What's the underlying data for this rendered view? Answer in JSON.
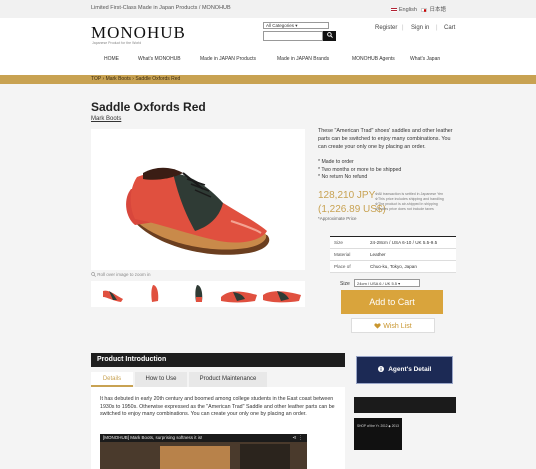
{
  "topbar": {
    "tagline": "Limited First-Class Made in Japan Products / MONOHUB",
    "lang_english": "English",
    "lang_japanese": "日本語"
  },
  "header": {
    "logo": "MONOHUB",
    "logo_subtitle": "Japanese Product for the World",
    "category_select": "All Categories",
    "search_placeholder": "",
    "register": "Register",
    "sign_in": "Sign in",
    "cart": "Cart",
    "separator": "|"
  },
  "nav": {
    "items": [
      "HOME",
      "What's MONOHUB",
      "Made in JAPAN Products",
      "Made in JAPAN Brands",
      "MONOHUB Agents",
      "What's Japan"
    ]
  },
  "breadcrumb": {
    "items": [
      "TOP",
      "Mark Boots",
      "Saddle Oxfords Red"
    ],
    "separator": "›"
  },
  "product": {
    "title": "Saddle Oxfords Red",
    "brand": "Mark Boots",
    "zoom_hint": "Roll over image to zoom in",
    "description": "These \"American Trad\" shoes' saddles and other leather parts can be switched to enjoy many combinations. You can create your only one by placing an order.",
    "bullets": [
      "* Made to order",
      "* Two months or more to be shipped",
      "* No return No refund"
    ],
    "price_jpy": "128,210 JPY",
    "price_usd": "(1,226.89 US$)",
    "approx_label": "*Approximate Price",
    "price_notes": [
      "※All transaction is settled in Japanese Yen",
      "※This price includes shipping and handling",
      "※The product is air-shipped in shipping",
      "※Duties price does not include taxes"
    ],
    "specs": [
      {
        "key": "Size",
        "value": "24-28cm / USA 6-10 / UK 5.5-9.5"
      },
      {
        "key": "Material",
        "value": "Leather"
      },
      {
        "key": "Place of",
        "value": "Chuo-ku, Tokyo, Japan"
      }
    ],
    "size_label": "Size",
    "size_selected": "24cm / USA 6 / UK 5.5",
    "add_to_cart": "Add to Cart",
    "wish_list": "Wish List"
  },
  "intro": {
    "heading": "Product Introduction",
    "tabs": [
      "Details",
      "How to Use",
      "Product Maintenance"
    ],
    "active_tab": "Details",
    "text": "It has debuted in early 20th century and boomed among college students in the East coast between 1930s to 1950s. Otherwise expressed as the \"American Trad\" Saddle and other leather parts can be switched to enjoy many combinations. You can create your only one by placing an order.",
    "video_title": "[MONOHUB] Mark Boots, surprising softness it is!"
  },
  "sidebar": {
    "agent_button": "Agent's Detail",
    "badge_text": "SHOP of the Yr. 2012 ◆ 2013"
  },
  "colors": {
    "accent_gold": "#c8a252",
    "cart_button": "#d9a43c",
    "agent_button": "#1c2a55",
    "dark_header": "#1e1e1e"
  },
  "icons": {
    "search": "search-icon",
    "heart": "heart-icon",
    "info": "info-icon",
    "share": "share-icon",
    "more": "more-vertical-icon"
  }
}
